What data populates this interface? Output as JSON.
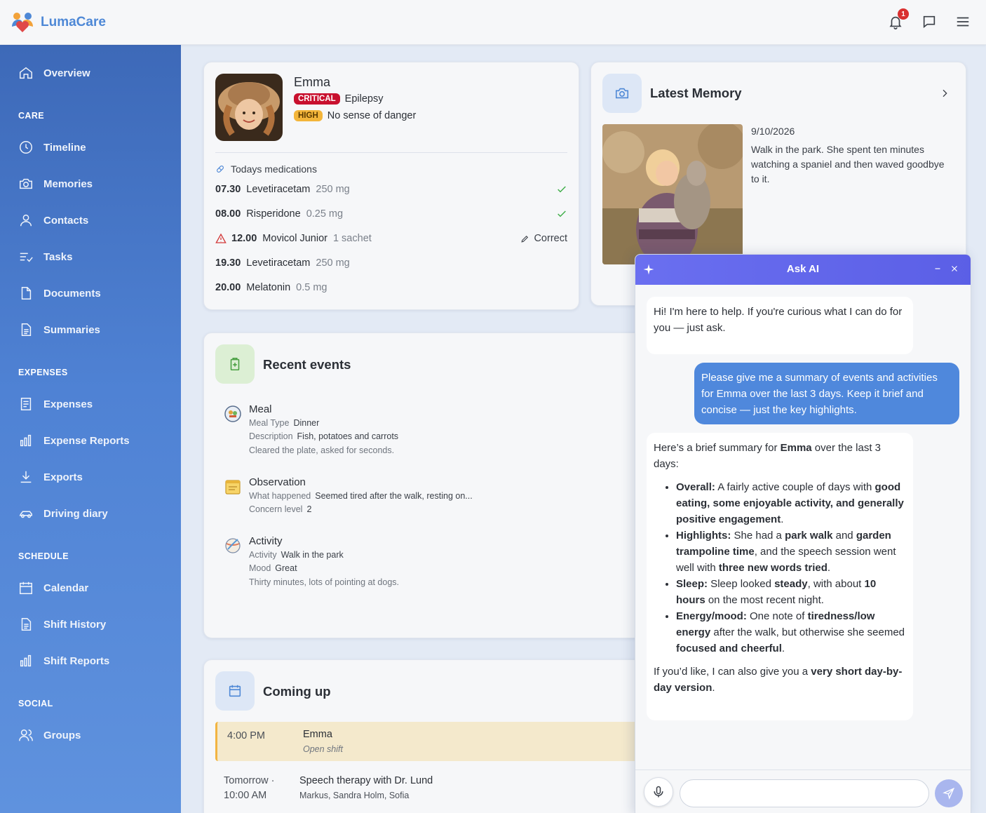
{
  "app": {
    "name": "LumaCare",
    "notification_count": "1"
  },
  "sidebar": {
    "overview": "Overview",
    "sections": {
      "care": "CARE",
      "expenses": "EXPENSES",
      "schedule": "SCHEDULE",
      "social": "SOCIAL"
    },
    "care_items": [
      "Timeline",
      "Memories",
      "Contacts",
      "Tasks",
      "Documents",
      "Summaries"
    ],
    "expense_items": [
      "Expenses",
      "Expense Reports",
      "Exports",
      "Driving diary"
    ],
    "schedule_items": [
      "Calendar",
      "Shift History",
      "Shift Reports"
    ],
    "social_items": [
      "Groups"
    ]
  },
  "profile": {
    "name": "Emma",
    "conditions": [
      {
        "level": "CRITICAL",
        "text": "Epilepsy",
        "color": "#c8102e"
      },
      {
        "level": "HIGH",
        "text": "No sense of danger",
        "color": "#f3b53a"
      }
    ],
    "medications_title": "Todays medications",
    "medications": [
      {
        "time": "07.30",
        "name": "Levetiracetam",
        "dose": "250 mg",
        "status": "done"
      },
      {
        "time": "08.00",
        "name": "Risperidone",
        "dose": "0.25 mg",
        "status": "done"
      },
      {
        "time": "12.00",
        "name": "Movicol Junior",
        "dose": "1 sachet",
        "status": "warning",
        "action": "Correct"
      },
      {
        "time": "19.30",
        "name": "Levetiracetam",
        "dose": "250 mg",
        "status": "pending"
      },
      {
        "time": "20.00",
        "name": "Melatonin",
        "dose": "0.5 mg",
        "status": "pending"
      }
    ]
  },
  "memory": {
    "title": "Latest Memory",
    "date": "9/10/2026",
    "text": "Walk in the park. She spent ten minutes watching a spaniel and then waved goodbye to it."
  },
  "events": {
    "title": "Recent events",
    "items": [
      {
        "title": "Meal",
        "lines": [
          {
            "label": "Meal Type",
            "value": "Dinner"
          },
          {
            "label": "Description",
            "value": "Fish, potatoes and carrots"
          }
        ],
        "note": "Cleared the plate, asked for seconds."
      },
      {
        "title": "Observation",
        "lines": [
          {
            "label": "What happened",
            "value": "Seemed tired after the walk, resting on..."
          },
          {
            "label": "Concern level",
            "value": "2"
          }
        ],
        "note": ""
      },
      {
        "title": "Activity",
        "lines": [
          {
            "label": "Activity",
            "value": "Walk in the park"
          },
          {
            "label": "Mood",
            "value": "Great"
          }
        ],
        "note": "Thirty minutes, lots of pointing at dogs."
      }
    ]
  },
  "coming_up": {
    "title": "Coming up",
    "shift": {
      "time": "4:00 PM",
      "name": "Emma",
      "sub": "Open shift"
    },
    "appointment": {
      "when_line1": "Tomorrow ·",
      "when_line2": "10:00 AM",
      "title": "Speech therapy with Dr. Lund",
      "people": "Markus, Sandra Holm, Sofia"
    }
  },
  "chat": {
    "title": "Ask AI",
    "greeting": "Hi! I'm here to help. If you're curious what I can do for you — just ask.",
    "user_message": "Please give me a summary of events and activities for Emma over the last 3 days. Keep it brief and concise — just the key highlights.",
    "reply": {
      "intro_pre": "Here’s a brief summary for ",
      "intro_name": "Emma",
      "intro_post": " over the last 3 days:",
      "outro_pre": "If you’d like, I can also give you a ",
      "outro_bold": "very short day-by-day version",
      "outro_post": "."
    },
    "input_placeholder": "",
    "accent_color": "#5b5fe6"
  }
}
